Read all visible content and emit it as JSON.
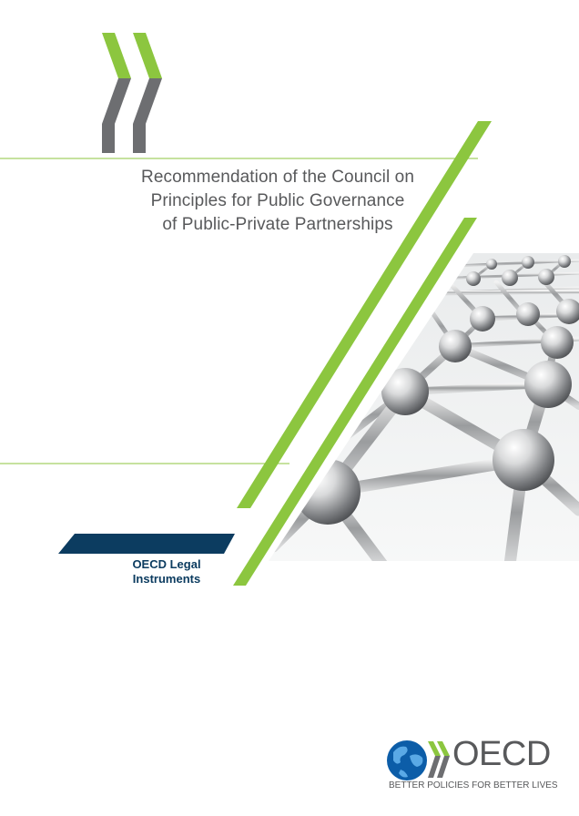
{
  "cover": {
    "title_lines": [
      "Recommendation of the Council on",
      "Principles for Public Governance",
      "of Public-Private Partnerships"
    ],
    "series_lines": [
      "OECD Legal",
      "Instruments"
    ]
  },
  "footer": {
    "wordmark": "OECD",
    "tagline": "BETTER POLICIES FOR BETTER LIVES"
  },
  "colors": {
    "green": "#8cc63f",
    "grey": "#6d6e71",
    "navy": "#0c3c60",
    "text": "#58595b"
  },
  "icons": [
    "oecd-chevrons-logo",
    "oecd-globe-logo",
    "network-image"
  ]
}
